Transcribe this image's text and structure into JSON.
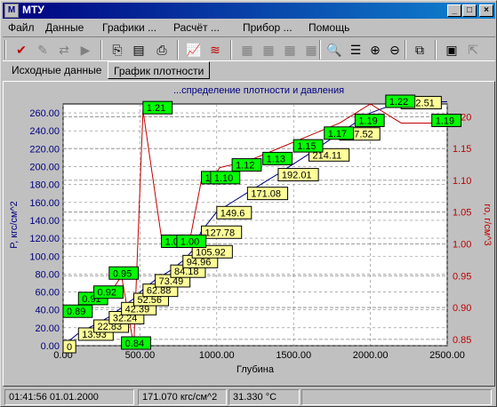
{
  "window": {
    "title": "МТУ",
    "icon": "app-icon"
  },
  "menu": [
    "Файл",
    "Данные",
    "Графики ...",
    "Расчёт ...",
    "Прибор ...",
    "Помощь"
  ],
  "tabs": [
    {
      "label": "Исходные данные"
    },
    {
      "label": "График плотности"
    }
  ],
  "chart_data": {
    "type": "line",
    "title": "...спределение плотности и давления",
    "xlabel": "Глубина",
    "ylabel_left": "P, кгс/см^2",
    "ylabel_right": "ro, г/см^3",
    "xlim": [
      0,
      2500
    ],
    "ylim_left": [
      0,
      270
    ],
    "ylim_right": [
      0.84,
      1.22
    ],
    "x_ticks": [
      "0.00",
      "500.00",
      "1000.00",
      "1500.00",
      "2000.00",
      "2500.00"
    ],
    "x_tick_labels_visible": [
      "0.00",
      "500.00",
      "1",
      "000.00",
      "500.00",
      "2",
      "000.00",
      "500.00",
      "2"
    ],
    "y_left_ticks": [
      "0.00",
      "20.00",
      "40.00",
      "60.00",
      "80.00",
      "100.00",
      "120.00",
      "140.00",
      "160.00",
      "180.00",
      "200.00",
      "220.00",
      "240.00",
      "260.00"
    ],
    "y_right_ticks": [
      "0.85",
      "0.90",
      "0.95",
      "1.00",
      "1.05",
      "1.10",
      "1.15",
      "1.20"
    ],
    "grid": true,
    "series": [
      {
        "name": "P",
        "color": "#000080",
        "x": [
          0,
          100,
          200,
          300,
          380,
          460,
          520,
          600,
          700,
          780,
          840,
          900,
          1000,
          1200,
          1400,
          1600,
          1800,
          2000,
          2200,
          2500
        ],
        "values": [
          0,
          13.93,
          22.83,
          32.24,
          42.39,
          52.56,
          62.88,
          73.49,
          84.18,
          94.96,
          105.92,
          127.78,
          149.6,
          171.08,
          192.01,
          214.11,
          237.52,
          260,
          272.51,
          272.51
        ],
        "labels": [
          "0",
          "13.93",
          "22.83",
          "32.24",
          "42.39",
          "52.56",
          "62.88",
          "73.49",
          "84.18",
          "94.96",
          "105.92",
          "127.78",
          "149.6",
          "171.08",
          "192.01",
          "214.11",
          "237.52",
          "272.51"
        ]
      },
      {
        "name": "ro",
        "color": "#c00000",
        "x": [
          0,
          100,
          200,
          300,
          380,
          460,
          520,
          640,
          740,
          820,
          900,
          960,
          1020,
          1200,
          1400,
          1600,
          1800,
          2000,
          2200,
          2500
        ],
        "values": [
          0.89,
          0.89,
          0.91,
          0.92,
          0.95,
          0.84,
          1.21,
          1.01,
          1.0,
          1.0,
          1.1,
          1.1,
          1.12,
          1.13,
          1.15,
          1.17,
          1.19,
          1.22,
          1.19,
          1.19
        ],
        "labels": [
          "0.89",
          "0.91",
          "0.92",
          "0.95",
          "0.84",
          "1.21",
          "1.0",
          "1.00",
          "1.1",
          "1.10",
          "1.12",
          "1.13",
          "1.15",
          "1.17",
          "1.19",
          "1.22",
          "1.19"
        ]
      }
    ]
  },
  "status": {
    "datetime": "01:41:56 01.01.2000",
    "pressure": "171.070 кгс/см^2",
    "temperature": "31.330 °C"
  },
  "colors": {
    "title_bar": "#000080",
    "pressure_labels": "#ffff99",
    "density_labels": "#00ff00"
  }
}
